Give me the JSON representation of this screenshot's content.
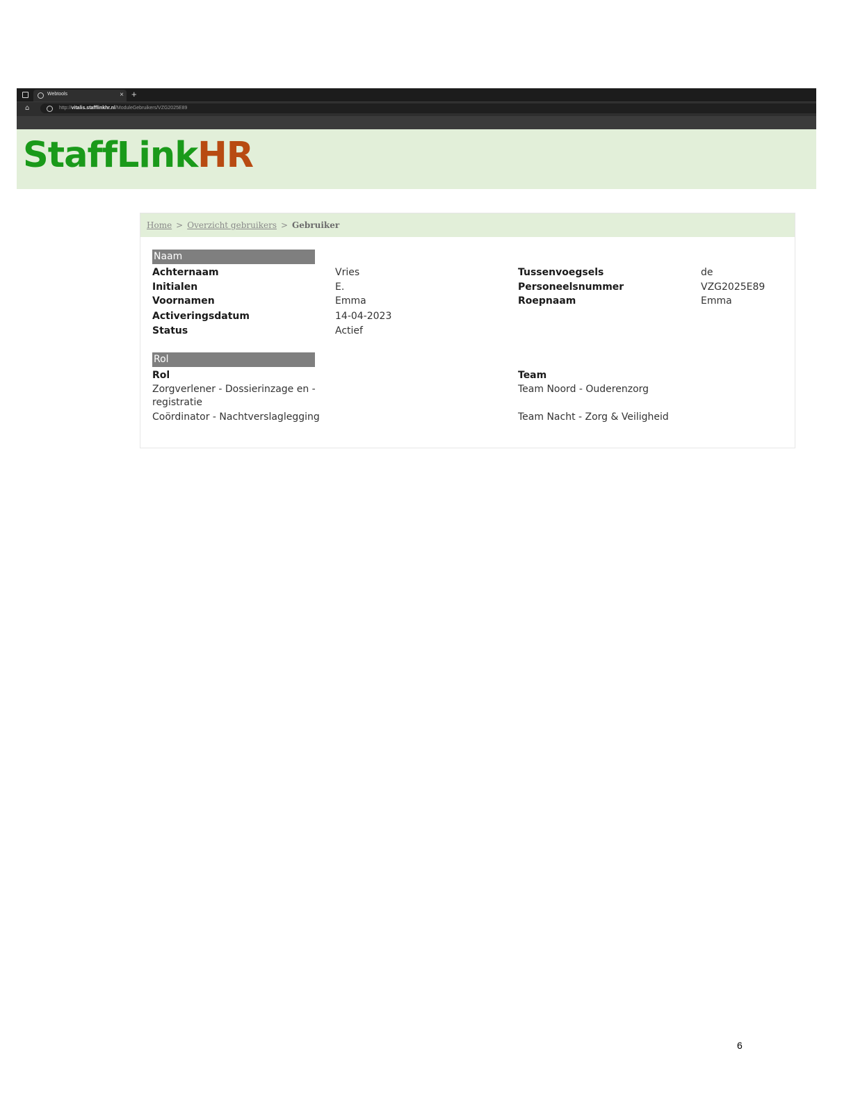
{
  "browser": {
    "tab_title": "Webtools",
    "tab_close": "×",
    "new_tab": "+",
    "url_prefix": "http://",
    "url_host": "vitalis.stafflinkhr.nl",
    "url_path": "/ModuleGebruikers/VZG2025E89"
  },
  "app": {
    "logo_part1": "StaffLink",
    "logo_part2": "HR"
  },
  "breadcrumb": {
    "home": "Home",
    "overview": "Overzicht gebruikers",
    "current": "Gebruiker",
    "separator": ">"
  },
  "naam": {
    "section_title": "Naam",
    "achternaam_label": "Achternaam",
    "achternaam": "Vries",
    "initialen_label": "Initialen",
    "initialen": "E.",
    "voornamen_label": "Voornamen",
    "voornamen": "Emma",
    "activeringsdatum_label": "Activeringsdatum",
    "activeringsdatum": "14-04-2023",
    "status_label": "Status",
    "status": "Actief",
    "tussenvoegsels_label": "Tussenvoegsels",
    "tussenvoegsels": "de",
    "personeelsnummer_label": "Personeelsnummer",
    "personeelsnummer": "VZG2025E89",
    "roepnaam_label": "Roepnaam",
    "roepnaam": "Emma"
  },
  "rol": {
    "section_title": "Rol",
    "rol_label": "Rol",
    "team_label": "Team",
    "rows": [
      {
        "rol": "Zorgverlener - Dossierinzage en - registratie",
        "team": "Team Noord - Ouderenzorg"
      },
      {
        "rol": "Coördinator - Nachtverslaglegging",
        "team": "Team Nacht - Zorg & Veiligheid"
      }
    ]
  },
  "page_number": "6",
  "colors": {
    "logo_green": "#1a9a1a",
    "logo_orange": "#b84b12",
    "header_bg": "#e2efd9",
    "section_bar": "#7f7f7f"
  }
}
